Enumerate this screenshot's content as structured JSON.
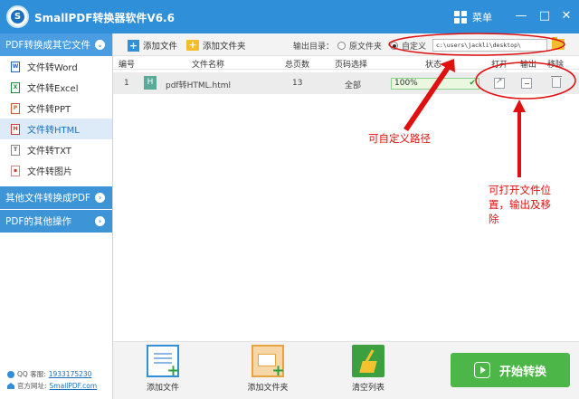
{
  "app": {
    "title": "SmallPDF转换器软件V6.6",
    "logo_letter": "S",
    "menu_label": "菜单"
  },
  "window_controls": {
    "minimize": "—",
    "maximize": "□",
    "close": "✕"
  },
  "sidebar": {
    "sections": [
      {
        "label": "PDF转换成其它文件",
        "expanded": true
      },
      {
        "label": "其他文件转换成PDF",
        "expanded": false
      },
      {
        "label": "PDF的其他操作",
        "expanded": false
      }
    ],
    "items": [
      {
        "label": "文件转Word",
        "icon": "word-file-icon",
        "glyph": "W"
      },
      {
        "label": "文件转Excel",
        "icon": "excel-file-icon",
        "glyph": "X"
      },
      {
        "label": "文件转PPT",
        "icon": "ppt-file-icon",
        "glyph": "P"
      },
      {
        "label": "文件转HTML",
        "icon": "html-file-icon",
        "glyph": "H",
        "active": true
      },
      {
        "label": "文件转TXT",
        "icon": "txt-file-icon",
        "glyph": "T"
      },
      {
        "label": "文件转图片",
        "icon": "image-file-icon",
        "glyph": "▪"
      }
    ],
    "contact": {
      "qq_label": "QQ 客服:",
      "qq_value": "1933175230",
      "site_label": "官方网址:",
      "site_value": "SmallPDF.com"
    }
  },
  "toolbar": {
    "add_file": "添加文件",
    "add_folder": "添加文件夹",
    "output_label": "输出目录：",
    "radio_original": "原文件夹",
    "radio_custom": "自定义",
    "selected": "custom",
    "path_value": "c:\\users\\jackli\\desktop\\"
  },
  "table": {
    "headers": {
      "index": "编号",
      "name": "文件名称",
      "pages": "总页数",
      "page_select": "页码选择",
      "status": "状态",
      "open": "打开",
      "output": "输出",
      "remove": "移除"
    },
    "rows": [
      {
        "index": "1",
        "type_glyph": "H",
        "name": "pdf转HTML.html",
        "pages": "13",
        "page_select": "全部",
        "progress": 100,
        "progress_text": "100%"
      }
    ]
  },
  "annotations": {
    "custom_path": "可自定义路径",
    "open_location": [
      "可打开文件位",
      "置，输出及移",
      "除"
    ],
    "color": "#e01010"
  },
  "bottom": {
    "add_file": "添加文件",
    "add_folder": "添加文件夹",
    "clear_list": "清空列表",
    "start": "开始转换"
  },
  "colors": {
    "titlebar": "#2f8fd8",
    "start_button": "#4cb748",
    "progress_border": "#8fd28f"
  }
}
